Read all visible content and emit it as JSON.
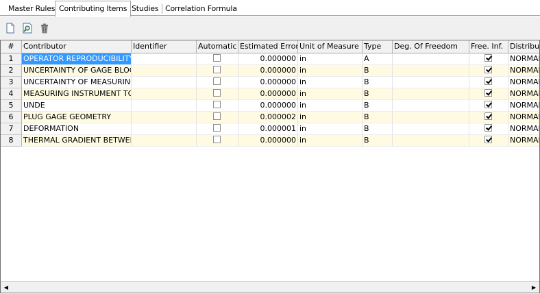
{
  "tabs": [
    {
      "label": "Master Rules",
      "active": false
    },
    {
      "label": "Contributing Items",
      "active": true
    },
    {
      "label": "Studies",
      "active": false
    },
    {
      "label": "Correlation Formula",
      "active": false
    }
  ],
  "toolbar": {
    "icons": [
      "new-document-icon",
      "preview-search-icon",
      "trash-icon"
    ]
  },
  "grid": {
    "columns": [
      "#",
      "Contributor",
      "Identifier",
      "Automatic",
      "Estimated Error",
      "Unit of Measure",
      "Type",
      "Deg. Of Freedom",
      "Free. Inf.",
      "Distributi"
    ],
    "rows": [
      {
        "num": "1",
        "contributor": "OPERATOR REPRODUCIBILITY",
        "identifier": "",
        "automatic": false,
        "error": "0.000000",
        "unit": "in",
        "type": "A",
        "dof": "",
        "free_inf": true,
        "dist": "NORMAL"
      },
      {
        "num": "2",
        "contributor": "UNCERTAINTY OF GAGE BLOCKS",
        "identifier": "",
        "automatic": false,
        "error": "0.000000",
        "unit": "in",
        "type": "B",
        "dof": "",
        "free_inf": true,
        "dist": "NORMAL"
      },
      {
        "num": "3",
        "contributor": "UNCERTAINTY OF MEASURING M",
        "identifier": "",
        "automatic": false,
        "error": "0.000000",
        "unit": "in",
        "type": "B",
        "dof": "",
        "free_inf": true,
        "dist": "NORMAL"
      },
      {
        "num": "4",
        "contributor": "MEASURING INSTRUMENT TO AF",
        "identifier": "",
        "automatic": false,
        "error": "0.000000",
        "unit": "in",
        "type": "B",
        "dof": "",
        "free_inf": true,
        "dist": "NORMAL"
      },
      {
        "num": "5",
        "contributor": "UNDE",
        "identifier": "",
        "automatic": false,
        "error": "0.000000",
        "unit": "in",
        "type": "B",
        "dof": "",
        "free_inf": true,
        "dist": "NORMAL"
      },
      {
        "num": "6",
        "contributor": "PLUG GAGE GEOMETRY",
        "identifier": "",
        "automatic": false,
        "error": "0.000002",
        "unit": "in",
        "type": "B",
        "dof": "",
        "free_inf": true,
        "dist": "NORMAL"
      },
      {
        "num": "7",
        "contributor": "DEFORMATION",
        "identifier": "",
        "automatic": false,
        "error": "0.000001",
        "unit": "in",
        "type": "B",
        "dof": "",
        "free_inf": true,
        "dist": "NORMAL"
      },
      {
        "num": "8",
        "contributor": "THERMAL GRADIENT BETWEEN M",
        "identifier": "",
        "automatic": false,
        "error": "0.000000",
        "unit": "in",
        "type": "B",
        "dof": "",
        "free_inf": true,
        "dist": "NORMAL"
      }
    ],
    "selected_row": 0
  },
  "colors": {
    "selection": "#3399ff",
    "alt_row": "#fffbe3",
    "header_bg": "#f1f1f1"
  }
}
